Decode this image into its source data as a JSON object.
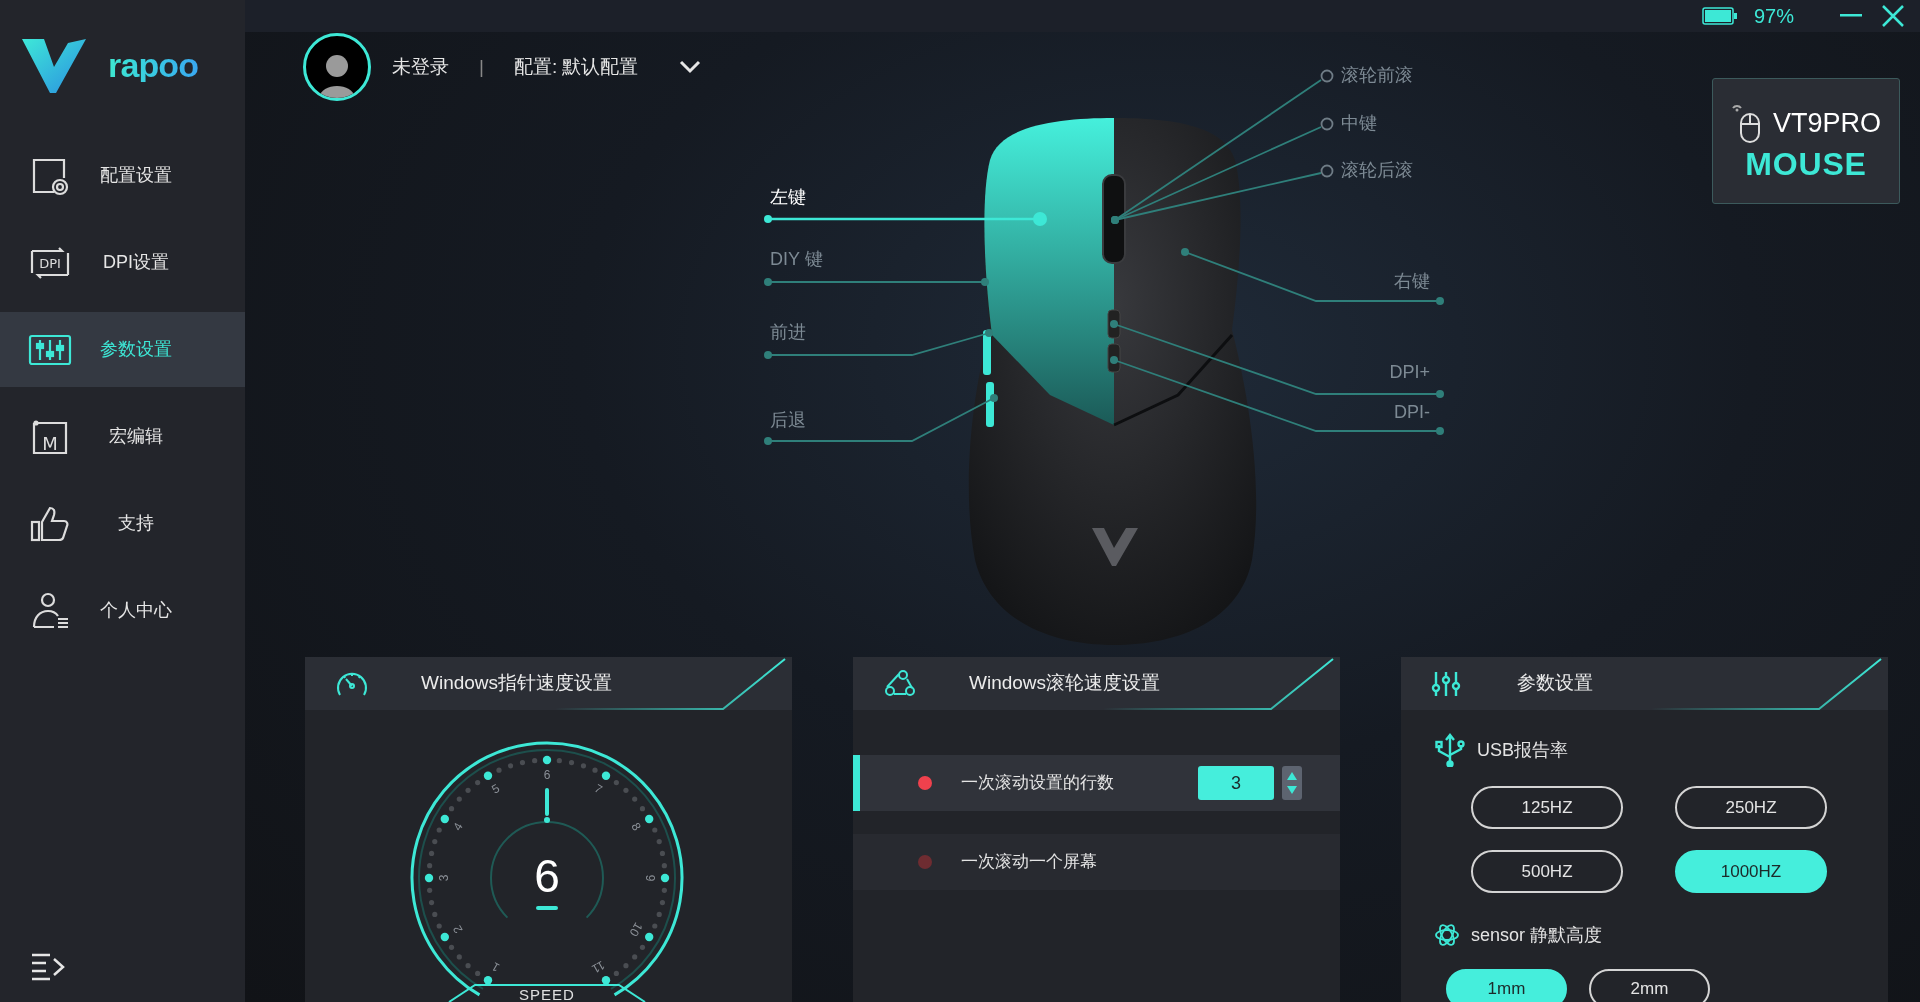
{
  "title_bar": {
    "battery": "97%"
  },
  "logo": {
    "text": "rapoo"
  },
  "sidebar": {
    "items": [
      {
        "label": "配置设置",
        "selected": false
      },
      {
        "label": "DPI设置",
        "selected": false,
        "icon_text": "DPI"
      },
      {
        "label": "参数设置",
        "selected": true
      },
      {
        "label": "宏编辑",
        "selected": false,
        "icon_text": "M"
      },
      {
        "label": "支持",
        "selected": false
      },
      {
        "label": "个人中心",
        "selected": false
      }
    ]
  },
  "header": {
    "user": "未登录",
    "separator": "|",
    "profile": "配置: 默认配置"
  },
  "device": {
    "model": "VT9PRO",
    "type": "MOUSE"
  },
  "mouse_buttons": [
    {
      "label": "左键",
      "selected": true
    },
    {
      "label": "DIY 键",
      "selected": false
    },
    {
      "label": "前进",
      "selected": false
    },
    {
      "label": "后退",
      "selected": false
    },
    {
      "label": "滚轮前滚",
      "selected": false
    },
    {
      "label": "中键",
      "selected": false
    },
    {
      "label": "滚轮后滚",
      "selected": false
    },
    {
      "label": "右键",
      "selected": false
    },
    {
      "label": "DPI+",
      "selected": false
    },
    {
      "label": "DPI-",
      "selected": false
    }
  ],
  "pointer_panel": {
    "title": "Windows指针速度设置",
    "gauge": {
      "value": "6",
      "level": 0.5,
      "ticks": [
        "1",
        "2",
        "3",
        "4",
        "5",
        "6",
        "7",
        "8",
        "9",
        "10",
        "11"
      ],
      "label": "SPEED"
    }
  },
  "scroll_panel": {
    "title": "Windows滚轮速度设置",
    "options": [
      {
        "label": "一次滚动设置的行数",
        "selected": true,
        "value": "3"
      },
      {
        "label": "一次滚动一个屏幕",
        "selected": false
      }
    ]
  },
  "params_panel": {
    "title": "参数设置",
    "sections": [
      {
        "label": "USB报告率",
        "options": [
          {
            "label": "125HZ",
            "selected": false
          },
          {
            "label": "250HZ",
            "selected": false
          },
          {
            "label": "500HZ",
            "selected": false
          },
          {
            "label": "1000HZ",
            "selected": true
          }
        ]
      },
      {
        "label": "sensor 静默高度",
        "options": [
          {
            "label": "1mm",
            "selected": true
          },
          {
            "label": "2mm",
            "selected": false
          }
        ]
      }
    ]
  }
}
